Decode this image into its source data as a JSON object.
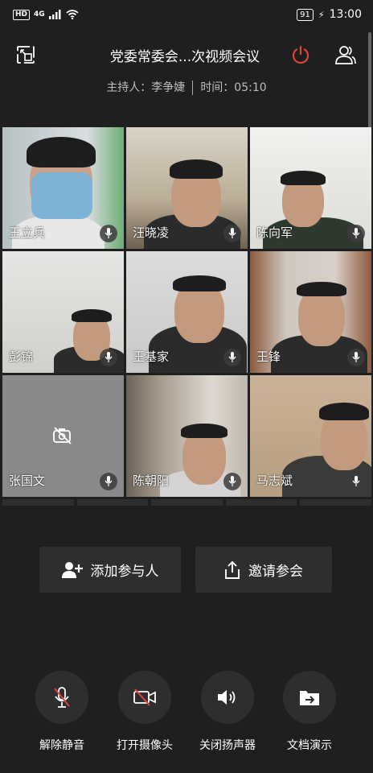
{
  "status_bar": {
    "hd": "HD",
    "network": "4G",
    "battery": "91",
    "time": "13:00"
  },
  "header": {
    "title": "党委常委会...次视频会议",
    "host_label": "主持人：李争婕",
    "time_label": "时间：05:10"
  },
  "participants": [
    {
      "name": "王立兵"
    },
    {
      "name": "汪晓凌"
    },
    {
      "name": "陈向军"
    },
    {
      "name": "彭锦"
    },
    {
      "name": "王基家"
    },
    {
      "name": "王锋"
    },
    {
      "name": "张国文"
    },
    {
      "name": "陈朝阳"
    },
    {
      "name": "马志斌"
    }
  ],
  "actions": {
    "add_participant": "添加参与人",
    "invite": "邀请参会"
  },
  "controls": {
    "unmute": "解除静音",
    "open_camera": "打开摄像头",
    "close_speaker": "关闭扬声器",
    "share_doc": "文档演示"
  },
  "colors": {
    "background": "#1f1f1f",
    "button": "#2e2e2e",
    "end_call": "#e0443a"
  }
}
